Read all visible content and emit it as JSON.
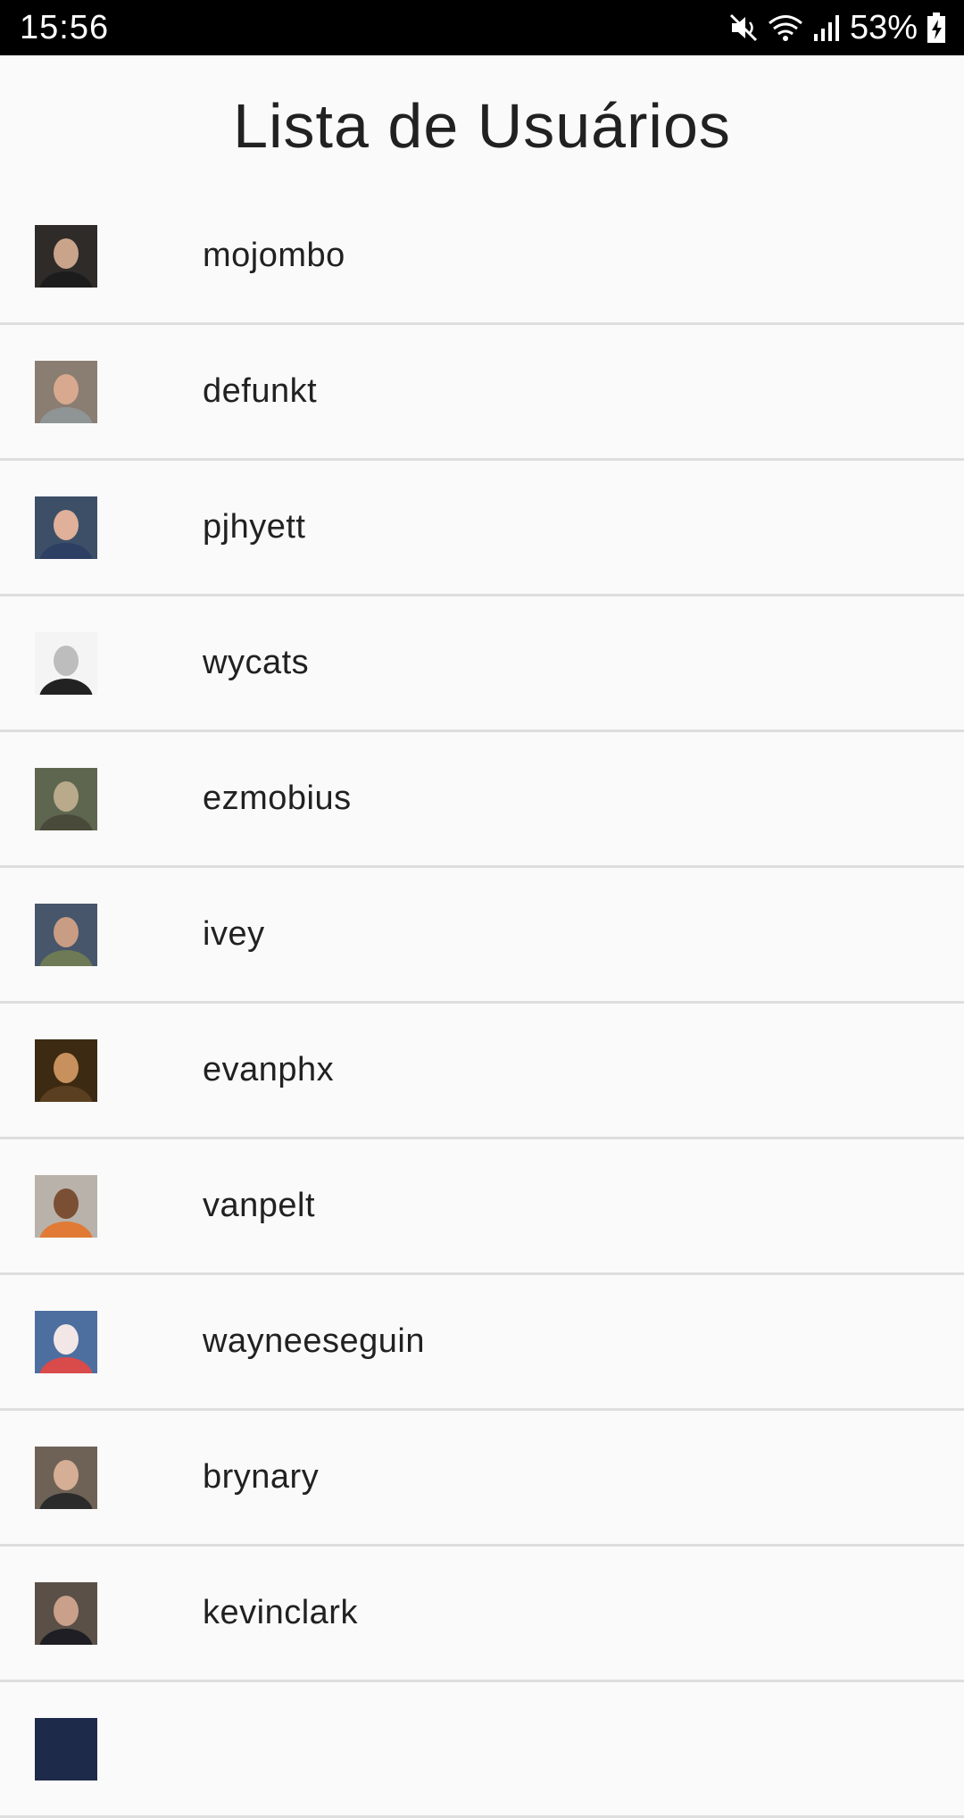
{
  "status_bar": {
    "time": "15:56",
    "battery": "53%",
    "icons": [
      "mute-icon",
      "wifi-icon",
      "signal-icon",
      "battery-charging-icon"
    ]
  },
  "header": {
    "title": "Lista de Usuários"
  },
  "users": [
    {
      "login": "mojombo",
      "avatar_bg": "#2e2b29",
      "avatar_skin": "#c9a48a",
      "avatar_shirt": "#1c1c1c"
    },
    {
      "login": "defunkt",
      "avatar_bg": "#8a7d72",
      "avatar_skin": "#d8a98f",
      "avatar_shirt": "#8f9595"
    },
    {
      "login": "pjhyett",
      "avatar_bg": "#3c4f67",
      "avatar_skin": "#e0b09a",
      "avatar_shirt": "#2d3f63"
    },
    {
      "login": "wycats",
      "avatar_bg": "#f4f4f4",
      "avatar_skin": "#bdbdbd",
      "avatar_shirt": "#222222"
    },
    {
      "login": "ezmobius",
      "avatar_bg": "#5e6650",
      "avatar_skin": "#b8aa8a",
      "avatar_shirt": "#4a4a3a"
    },
    {
      "login": "ivey",
      "avatar_bg": "#47566a",
      "avatar_skin": "#c99c84",
      "avatar_shirt": "#6d7a55"
    },
    {
      "login": "evanphx",
      "avatar_bg": "#3d2a12",
      "avatar_skin": "#c7905d",
      "avatar_shirt": "#5a4020"
    },
    {
      "login": "vanpelt",
      "avatar_bg": "#b9b2ab",
      "avatar_skin": "#7a4f33",
      "avatar_shirt": "#e07a35"
    },
    {
      "login": "wayneeseguin",
      "avatar_bg": "#4d6fa0",
      "avatar_skin": "#f2e6e6",
      "avatar_shirt": "#d94a4a"
    },
    {
      "login": "brynary",
      "avatar_bg": "#6e6256",
      "avatar_skin": "#d6ad95",
      "avatar_shirt": "#2b2b2b"
    },
    {
      "login": "kevinclark",
      "avatar_bg": "#5a5048",
      "avatar_skin": "#caa08a",
      "avatar_shirt": "#1e1e24"
    },
    {
      "login": "",
      "avatar_bg": "#1e2a4a",
      "avatar_skin": "#1e2a4a",
      "avatar_shirt": "#1e2a4a"
    }
  ]
}
